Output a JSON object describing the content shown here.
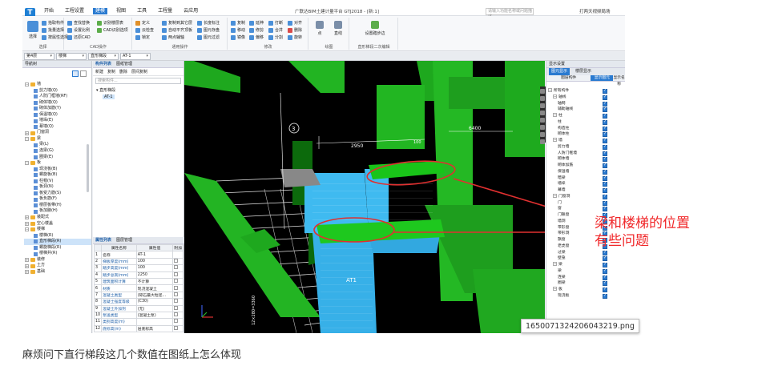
{
  "window": {
    "title": "广联达BIM土建计量平台 GTJ2018 - [新:1]",
    "search_placeholder": "请输入功能名称或问题描述",
    "right_label": "打两天视频局场",
    "menus": [
      "开始",
      "工程设置",
      "建模",
      "视图",
      "工具",
      "工程量",
      "云应用"
    ],
    "active_menu": "建模"
  },
  "ribbon": {
    "groups": [
      {
        "label": "选择",
        "items": [
          "选择",
          "拾取构件",
          "批量选择",
          "按属性选择"
        ]
      },
      {
        "label": "CAD操作",
        "items": [
          "查找替换",
          "设置比例",
          "还原CAD",
          "识别楼层表",
          "CAD识别选项"
        ]
      },
      {
        "label": "通用操作",
        "items": [
          "定义",
          "复制到其它层",
          "云检查",
          "自动平齐顶板",
          "锁定",
          "图元存盘",
          "两点辅轴",
          "长度标注",
          "图元过滤"
        ]
      },
      {
        "label": "修改",
        "items": [
          "复制",
          "移动",
          "镜像",
          "延伸",
          "修剪",
          "偏移",
          "打断",
          "合并",
          "分割",
          "对齐",
          "删除",
          "旋转"
        ]
      },
      {
        "label": "绘图",
        "items": [
          "点",
          "直线"
        ]
      },
      {
        "label": "直形梯段二次编辑",
        "items": [
          "设置踏步边"
        ]
      }
    ]
  },
  "selectors": {
    "floor": "第4层",
    "category": "楼梯",
    "type": "直形梯段",
    "element": "AT-1"
  },
  "nav": {
    "header": "导航树",
    "items": [
      {
        "label": "墙",
        "type": "folder",
        "level": 0,
        "expanded": true
      },
      {
        "label": "剪力墙(Q)",
        "level": 1
      },
      {
        "label": "人防门框墙(RF)",
        "level": 1
      },
      {
        "label": "砌体墙(Q)",
        "level": 1
      },
      {
        "label": "砌体加筋(Y)",
        "level": 1
      },
      {
        "label": "保温墙(Q)",
        "level": 1
      },
      {
        "label": "墙垛(E)",
        "level": 1
      },
      {
        "label": "幕墙(Q)",
        "level": 1
      },
      {
        "label": "门窗洞",
        "type": "folder",
        "level": 0
      },
      {
        "label": "梁",
        "type": "folder",
        "level": 0,
        "expanded": true
      },
      {
        "label": "梁(L)",
        "level": 1
      },
      {
        "label": "连梁(G)",
        "level": 1
      },
      {
        "label": "圈梁(E)",
        "level": 1
      },
      {
        "label": "板",
        "type": "folder",
        "level": 0,
        "expanded": true
      },
      {
        "label": "现浇板(B)",
        "level": 1
      },
      {
        "label": "螺旋板(B)",
        "level": 1
      },
      {
        "label": "柱帽(V)",
        "level": 1
      },
      {
        "label": "板洞(N)",
        "level": 1
      },
      {
        "label": "板受力筋(S)",
        "level": 1
      },
      {
        "label": "板负筋(F)",
        "level": 1
      },
      {
        "label": "楼层板带(H)",
        "level": 1
      },
      {
        "label": "板加腋(H)",
        "level": 1
      },
      {
        "label": "装配式",
        "type": "folder",
        "level": 0
      },
      {
        "label": "空心楼盖",
        "type": "folder",
        "level": 0
      },
      {
        "label": "楼梯",
        "type": "folder",
        "level": 0,
        "expanded": true
      },
      {
        "label": "楼梯(R)",
        "level": 1
      },
      {
        "label": "直形梯段(R)",
        "level": 1,
        "selected": true
      },
      {
        "label": "螺旋梯段(R)",
        "level": 1
      },
      {
        "label": "楼梯井(R)",
        "level": 1
      },
      {
        "label": "装修",
        "type": "folder",
        "level": 0
      },
      {
        "label": "土方",
        "type": "folder",
        "level": 0
      },
      {
        "label": "基础",
        "type": "folder",
        "level": 0
      }
    ]
  },
  "components": {
    "tabs": [
      "构件列表",
      "图纸管理"
    ],
    "toolbar": [
      "新建",
      "复制",
      "删除",
      "层间复制"
    ],
    "search_placeholder": "搜索构件...",
    "tree_root": "直形梯段",
    "tree_item": "AT-1"
  },
  "properties": {
    "tabs": [
      "属性列表",
      "图层管理"
    ],
    "headers": [
      "属性名称",
      "属性值",
      "附加"
    ],
    "rows": [
      [
        "1",
        "名称",
        "AT-1"
      ],
      [
        "2",
        "梯板厚度(mm)",
        "100"
      ],
      [
        "3",
        "踏步高度(mm)",
        "100"
      ],
      [
        "4",
        "踏步总高(mm)",
        "2250"
      ],
      [
        "5",
        "建筑面积计算",
        "不计算"
      ],
      [
        "6",
        "材质",
        "现浇混凝土"
      ],
      [
        "7",
        "混凝土类型",
        "(碎石最大粒径..."
      ],
      [
        "8",
        "混凝土强度等级",
        "(C30)"
      ],
      [
        "9",
        "混凝土外加剂",
        "(无)"
      ],
      [
        "10",
        "泵送类型",
        "(混凝土泵)"
      ],
      [
        "11",
        "类别高度(m)",
        ""
      ],
      [
        "12",
        "底标高(m)",
        "层底标高"
      ]
    ]
  },
  "canvas": {
    "labels": [
      "3",
      "2950",
      "6400",
      "100",
      "AT1",
      "12×280=3360"
    ]
  },
  "display": {
    "title": "显示设置",
    "tabs": [
      "图元显示",
      "楼层显示"
    ],
    "headers": [
      "图层构件",
      "显示图元",
      "显示名称"
    ],
    "rows": [
      {
        "label": "所有构件",
        "level": 0,
        "toggle": true
      },
      {
        "label": "轴线",
        "level": 1,
        "toggle": true
      },
      {
        "label": "轴网",
        "level": 2
      },
      {
        "label": "辅助轴线",
        "level": 2
      },
      {
        "label": "柱",
        "level": 1,
        "toggle": true
      },
      {
        "label": "柱",
        "level": 2
      },
      {
        "label": "构造柱",
        "level": 2
      },
      {
        "label": "砌体柱",
        "level": 2
      },
      {
        "label": "墙",
        "level": 1,
        "toggle": true
      },
      {
        "label": "剪力墙",
        "level": 2
      },
      {
        "label": "人防门框墙",
        "level": 2
      },
      {
        "label": "砌体墙",
        "level": 2
      },
      {
        "label": "砌体加筋",
        "level": 2
      },
      {
        "label": "保温墙",
        "level": 2
      },
      {
        "label": "暗梁",
        "level": 2
      },
      {
        "label": "墙垛",
        "level": 2
      },
      {
        "label": "幕墙",
        "level": 2
      },
      {
        "label": "门窗洞",
        "level": 1,
        "toggle": true
      },
      {
        "label": "门",
        "level": 2
      },
      {
        "label": "窗",
        "level": 2
      },
      {
        "label": "门联窗",
        "level": 2
      },
      {
        "label": "墙洞",
        "level": 2
      },
      {
        "label": "带形窗",
        "level": 2
      },
      {
        "label": "带形洞",
        "level": 2
      },
      {
        "label": "飘窗",
        "level": 2
      },
      {
        "label": "老虎窗",
        "level": 2
      },
      {
        "label": "过梁",
        "level": 2
      },
      {
        "label": "壁龛",
        "level": 2
      },
      {
        "label": "梁",
        "level": 1,
        "toggle": true
      },
      {
        "label": "梁",
        "level": 2
      },
      {
        "label": "连梁",
        "level": 2
      },
      {
        "label": "圈梁",
        "level": 2
      },
      {
        "label": "板",
        "level": 1,
        "toggle": true
      },
      {
        "label": "现浇板",
        "level": 2
      }
    ]
  },
  "annotation": {
    "text_line1": "梁和楼梯的位置",
    "text_line2": "有些问题",
    "color": "#f0282a"
  },
  "file_tag": "1650071324206043219.png",
  "caption": "麻烦问下直行梯段这几个数值在图纸上怎么体现"
}
